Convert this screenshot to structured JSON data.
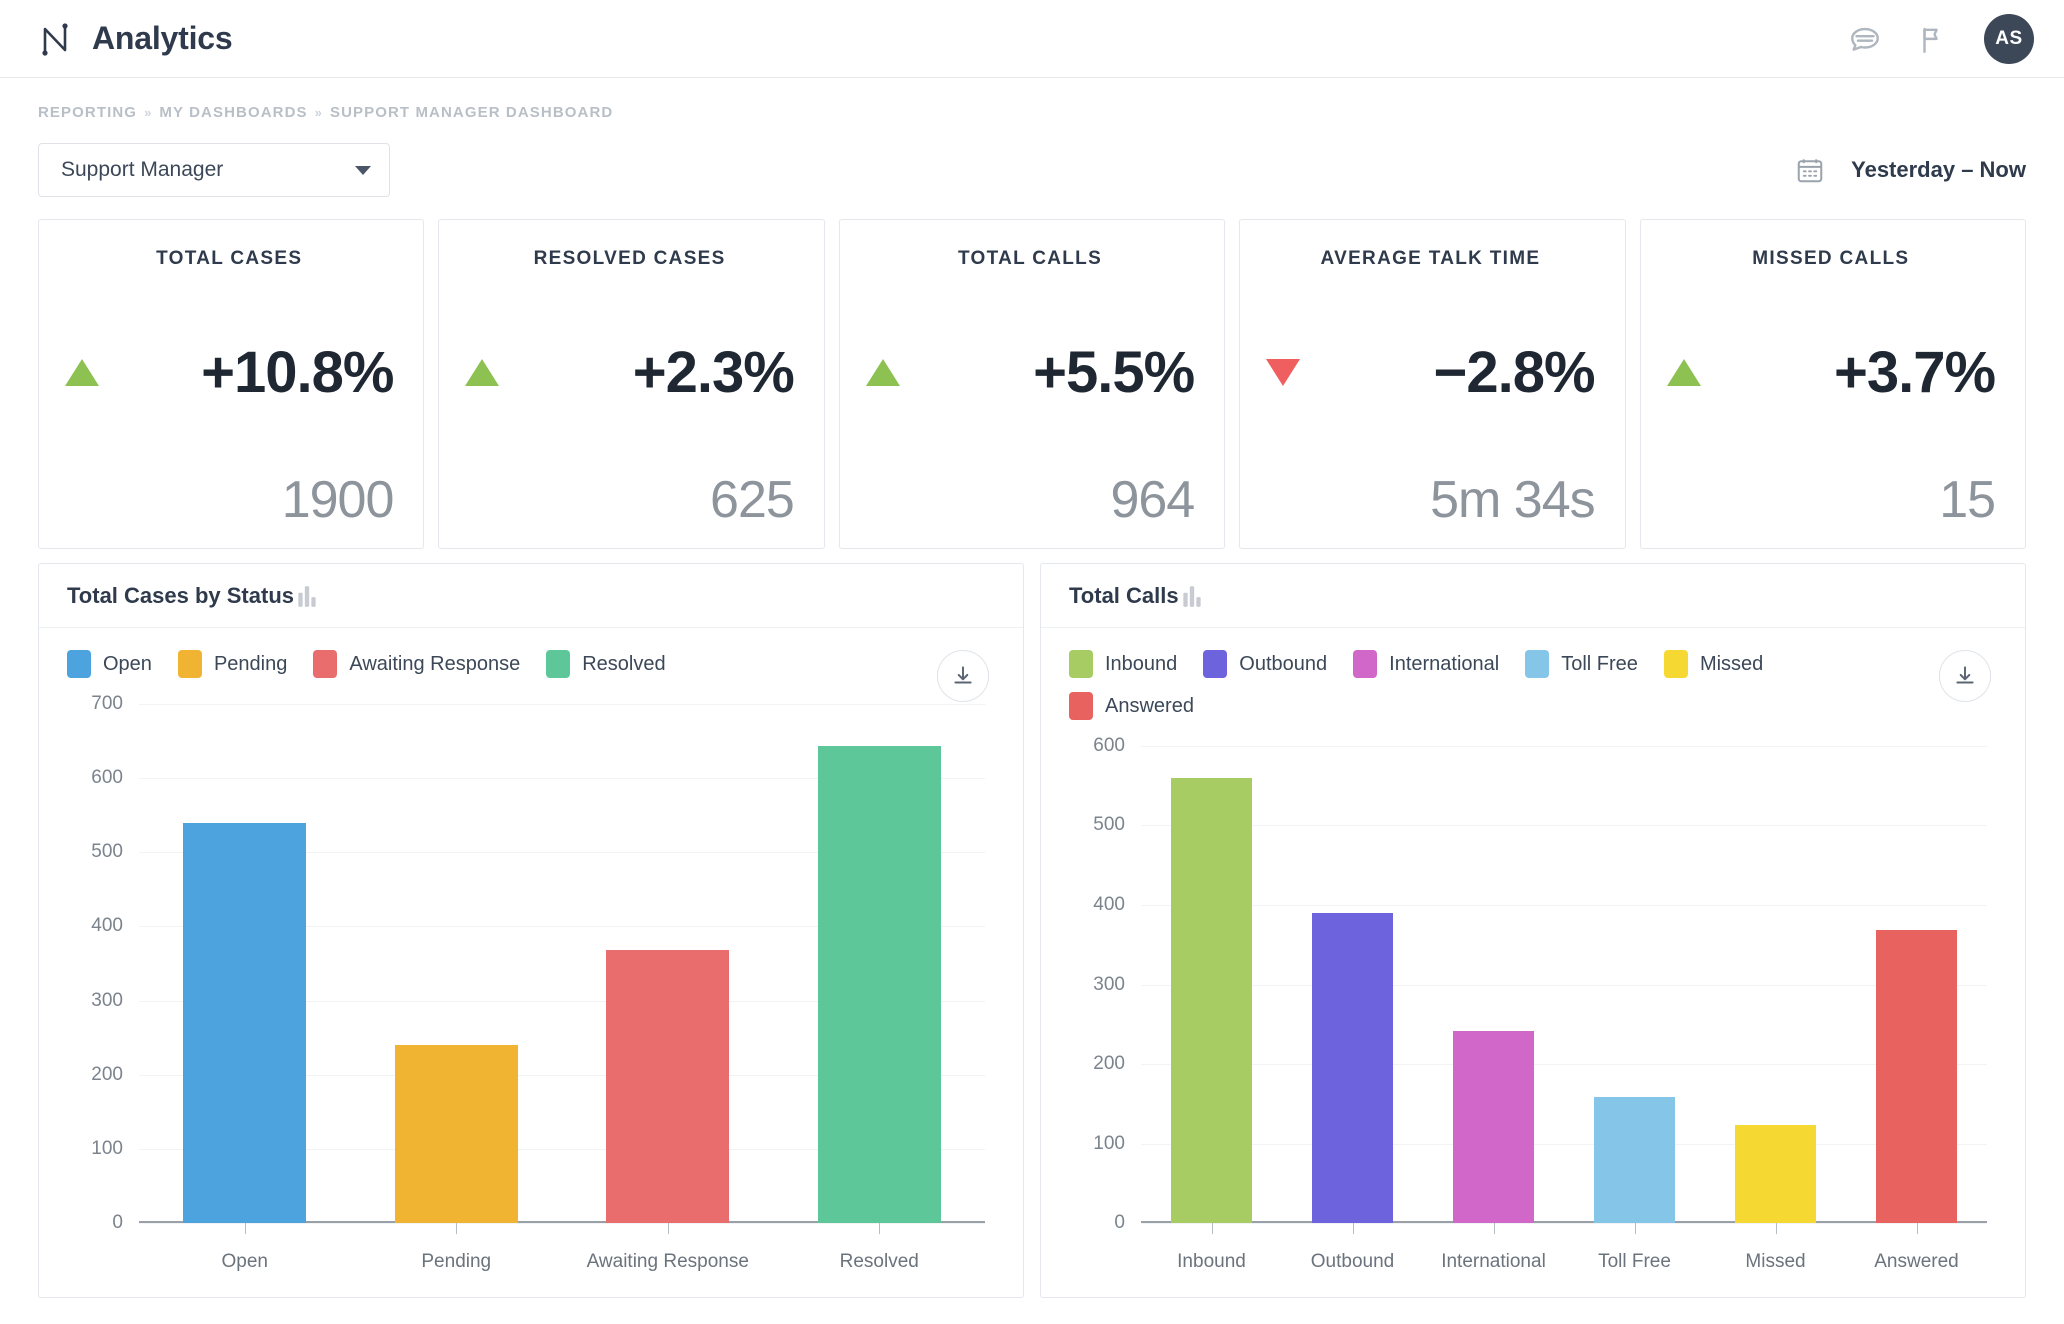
{
  "header": {
    "app_title": "Analytics",
    "logo_icon": "analytics-line-logo",
    "chat_icon": "chat-bubble-icon",
    "flag_icon": "flag-icon",
    "avatar_initials": "AS"
  },
  "breadcrumb": {
    "items": [
      "REPORTING",
      "MY DASHBOARDS",
      "SUPPORT MANAGER DASHBOARD"
    ],
    "separator": "»"
  },
  "filters": {
    "dashboard_select_value": "Support Manager",
    "caret_icon": "chevron-down-icon",
    "calendar_icon": "calendar-icon",
    "date_range": "Yesterday  –  Now"
  },
  "kpis": [
    {
      "title": "TOTAL CASES",
      "direction": "up",
      "percent": "+10.8%",
      "value": "1900"
    },
    {
      "title": "RESOLVED CASES",
      "direction": "up",
      "percent": "+2.3%",
      "value": "625"
    },
    {
      "title": "TOTAL CALLS",
      "direction": "up",
      "percent": "+5.5%",
      "value": "964"
    },
    {
      "title": "AVERAGE TALK TIME",
      "direction": "down",
      "percent": "−2.8%",
      "value": "5m 34s"
    },
    {
      "title": "MISSED CALLS",
      "direction": "up",
      "percent": "+3.7%",
      "value": "15"
    }
  ],
  "kpi_colors": {
    "up": "#8dc152",
    "down": "#f05f5f"
  },
  "panels": [
    {
      "title": "Total Cases by Status",
      "chart_icon": "bar-chart-icon",
      "download_icon": "download-icon"
    },
    {
      "title": "Total Calls",
      "chart_icon": "bar-chart-icon",
      "download_icon": "download-icon"
    }
  ],
  "chart_data": [
    {
      "type": "bar",
      "title": "Total Cases by Status",
      "categories": [
        "Open",
        "Pending",
        "Awaiting Response",
        "Resolved"
      ],
      "values": [
        540,
        240,
        368,
        643
      ],
      "colors": [
        "#4ca3dd",
        "#f1b432",
        "#ea6d6d",
        "#5dc79a"
      ],
      "legend": [
        "Open",
        "Pending",
        "Awaiting Response",
        "Resolved"
      ],
      "legend_position": "top-left",
      "xlabel": "",
      "ylabel": "",
      "ylim": [
        0,
        700
      ],
      "yticks": [
        0,
        100,
        200,
        300,
        400,
        500,
        600,
        700
      ],
      "grid": true
    },
    {
      "type": "bar",
      "title": "Total Calls",
      "categories": [
        "Inbound",
        "Outbound",
        "International",
        "Toll Free",
        "Missed",
        "Answered"
      ],
      "values": [
        560,
        390,
        242,
        158,
        123,
        368
      ],
      "colors": [
        "#a6cc63",
        "#6c63dd",
        "#d168c9",
        "#85c5e8",
        "#f5d831",
        "#e8625f"
      ],
      "legend": [
        "Inbound",
        "Outbound",
        "International",
        "Toll Free",
        "Missed",
        "Answered"
      ],
      "legend_position": "top-left",
      "xlabel": "",
      "ylabel": "",
      "ylim": [
        0,
        600
      ],
      "yticks": [
        0,
        100,
        200,
        300,
        400,
        500,
        600
      ],
      "grid": true
    }
  ]
}
